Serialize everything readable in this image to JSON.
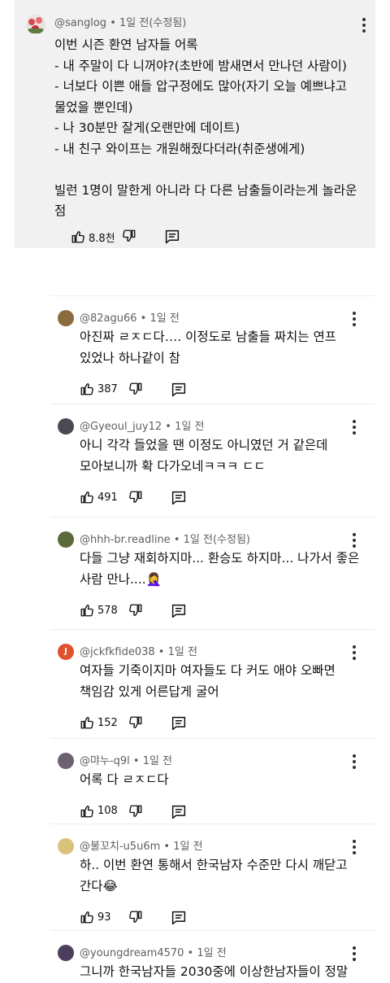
{
  "top_comment": {
    "author": "@sanglog",
    "time": "1일 전(수정됨)",
    "body": "이번 시즌 환연 남자들 어록\n- 내 주말이 다 니꺼야?(초반에 밤새면서 만나던 사람이)\n- 너보다 이쁜 애들 압구정에도 많아(자기 오늘 예쁘냐고\n물었을 뿐인데)\n- 나 30분만 잘게(오랜만에 데이트)\n- 내 친구 와이프는 개원해줬다더라(취준생에게)\n\n빌런 1명이 말한게 아니라 다 다른 남출들이라는게 놀라운\n점",
    "likes": "8.8천",
    "sep": " • "
  },
  "replies": [
    {
      "author": "@82agu66",
      "time": "1일 전",
      "body": "아진짜 ㄹㅈㄷ다…. 이정도로 남출들 짜치는 연프\n있었나 하나같이 참",
      "likes": "387",
      "avatar_color": "#8a6b3e"
    },
    {
      "author": "@Gyeoul_juy12",
      "time": "1일 전",
      "body": "아니 각각 들었을 땐 이정도 아니였던 거 같은데\n모아보니까 확 다가오네ㅋㅋㅋ ㄷㄷ",
      "likes": "491",
      "avatar_color": "#4a4a52"
    },
    {
      "author": "@hhh-br.readline",
      "time": "1일 전(수정됨)",
      "body": "다들 그냥 재회하지마... 환승도 하지마... 나가서 좋은\n사람 만나....🤦‍♀️",
      "likes": "578",
      "avatar_color": "#5a6a3a"
    },
    {
      "author": "@jckfkfide038",
      "time": "1일 전",
      "body": "여자들 기죽이지마 여자들도 다 커도 애야 오빠면\n책임감 있게 어른답게 굴어",
      "likes": "152",
      "avatar_color": "#e0522c",
      "avatar_letter": "J"
    },
    {
      "author": "@먀누-q9l",
      "time": "1일 전",
      "body": "어록 다 ㄹㅈㄷ다",
      "likes": "108",
      "avatar_color": "#6b6170"
    },
    {
      "author": "@불꼬치-u5u6m",
      "time": "1일 전",
      "body": "하.. 이번 환연 통해서 한국남자 수준만 다시 깨닫고\n간다😂",
      "likes": "93",
      "avatar_color": "#d9c27a"
    },
    {
      "author": "@youngdream4570",
      "time": "1일 전",
      "body": "그니까 한국남자들 2030중에 이상한남자들이 정말",
      "likes": "",
      "avatar_color": "#4b3e5c"
    }
  ]
}
